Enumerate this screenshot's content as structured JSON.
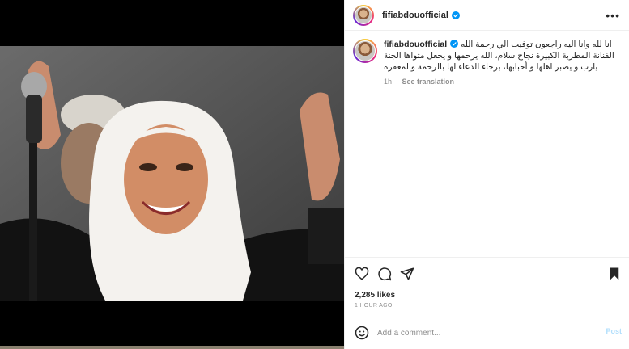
{
  "post": {
    "username": "fifiabdouofficial",
    "verified": true,
    "more_label": "•••"
  },
  "caption": {
    "username": "fifiabdouofficial",
    "text": "انا لله وانا اليه راجعون توفيت الي رحمة الله الفنانة المطربة الكبيرة نجاح سلام، الله يرحمها و يجعل مثواها الجنة يارب و يصبر اهلها و أحبابها، برجاء الدعاء لها بالرحمة والمغفرة",
    "time": "1h",
    "see_translation": "See translation"
  },
  "engagement": {
    "likes": "2,285 likes",
    "time_ago": "1 HOUR AGO"
  },
  "comment": {
    "placeholder": "Add a comment...",
    "post_label": "Post"
  },
  "icons": {
    "like": "heart-icon",
    "comment": "comment-icon",
    "share": "paper-plane-icon",
    "save": "bookmark-icon",
    "emoji": "smiley-icon",
    "verified": "verified-badge-icon"
  },
  "colors": {
    "verified_blue": "#0095f6",
    "post_button_disabled": "#b2dffc",
    "muted_text": "#8e8e8e"
  }
}
